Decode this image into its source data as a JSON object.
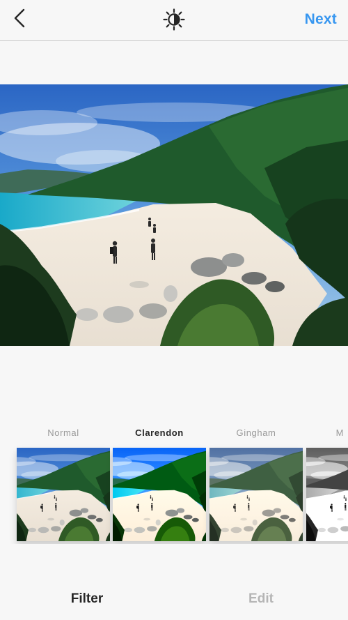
{
  "header": {
    "back_icon": "chevron-left-icon",
    "lux_icon": "lux-sun-icon",
    "next_label": "Next",
    "accent_color": "#3897f0"
  },
  "photo": {
    "description_icon": "beach-photo"
  },
  "filters": {
    "selected": "Clarendon",
    "items": [
      {
        "label": "Normal"
      },
      {
        "label": "Clarendon"
      },
      {
        "label": "Gingham"
      },
      {
        "label": "M"
      }
    ]
  },
  "tabs": [
    {
      "label": "Filter",
      "active": true
    },
    {
      "label": "Edit",
      "active": false
    }
  ]
}
